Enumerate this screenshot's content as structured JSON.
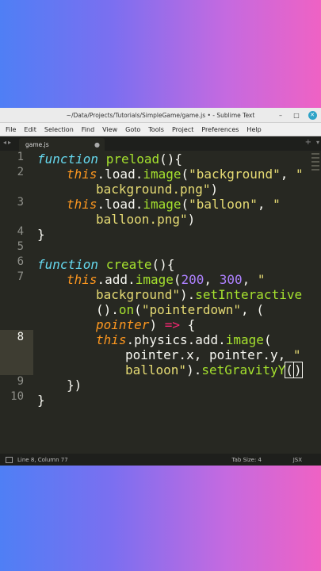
{
  "window": {
    "title": "~/Data/Projects/Tutorials/SimpleGame/game.js • - Sublime Text",
    "minimize_glyph": "–",
    "maximize_glyph": "□",
    "close_glyph": "✕"
  },
  "menu": [
    "File",
    "Edit",
    "Selection",
    "Find",
    "View",
    "Goto",
    "Tools",
    "Project",
    "Preferences",
    "Help"
  ],
  "tabs": {
    "nav": "◂▸",
    "active": "game.js",
    "dirty_marker": "●",
    "add": "+",
    "dropdown": "▾"
  },
  "editor": {
    "line_numbers": [
      "1",
      "2",
      "",
      "3",
      "",
      "4",
      "5",
      "6",
      "7",
      "",
      "",
      "8",
      "",
      "9",
      "10"
    ],
    "active_line": "8"
  },
  "status": {
    "position": "Line 8, Column 77",
    "tab_size": "Tab Size: 4",
    "syntax": "JSX"
  },
  "colors": {
    "background": "#272822",
    "keyword": "#66d9ef",
    "function": "#a6e22e",
    "this": "#fd971f",
    "string": "#e6db74",
    "number": "#ae81ff",
    "operator": "#f92672"
  },
  "code": {
    "l1": {
      "kw": "function",
      "fn": "preload",
      "rest": "(){"
    },
    "l2": {
      "this": "this",
      "a": ".load.",
      "fn": "image",
      "b": "(",
      "s": "\"background\"",
      "c": ", ",
      "s2": "\""
    },
    "l2b": {
      "s": "background.png\"",
      "c": ")"
    },
    "l3": {
      "this": "this",
      "a": ".load.",
      "fn": "image",
      "b": "(",
      "s": "\"balloon\"",
      "c": ", ",
      "s2": "\""
    },
    "l3b": {
      "s": "balloon.png\"",
      "c": ")"
    },
    "l4": "}",
    "l6": {
      "kw": "function",
      "fn": "create",
      "rest": "(){"
    },
    "l7": {
      "this": "this",
      "a": ".add.",
      "fn": "image",
      "b": "(",
      "n1": "200",
      "c": ", ",
      "n2": "300",
      "d": ", ",
      "s": "\""
    },
    "l7b": {
      "s": "background\"",
      "c": ").",
      "fn": "setInteractive"
    },
    "l7c": {
      "a": "().",
      "fn": "on",
      "b": "(",
      "s": "\"pointerdown\"",
      "c": ", ("
    },
    "l7d": {
      "t": "pointer",
      "a": ") ",
      "o": "=>",
      "b": " {"
    },
    "l8": {
      "this": "this",
      "a": ".physics.add.",
      "fn": "image",
      "b": "("
    },
    "l8b": {
      "a": "pointer.x, pointer.y, ",
      "s": "\""
    },
    "l8c": {
      "s": "balloon\"",
      "c": ").",
      "fn": "setGravityY",
      "p1": "(",
      "p2": ")"
    },
    "l9": "})",
    "l10": "}"
  }
}
